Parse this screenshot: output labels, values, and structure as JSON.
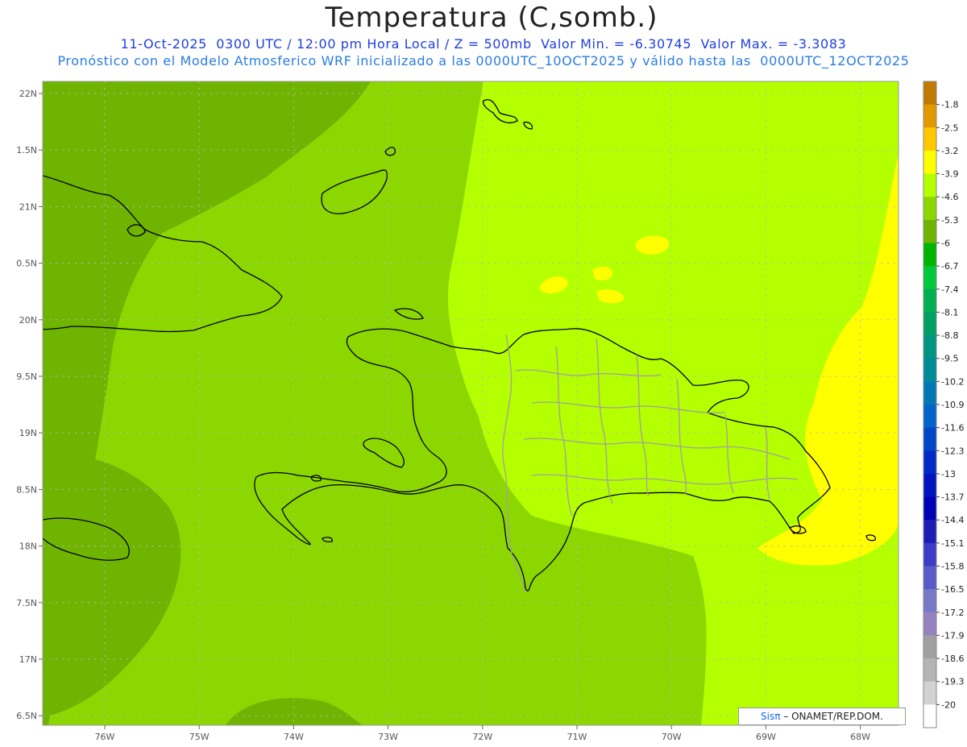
{
  "title": "Temperatura (C,somb.)",
  "subtitle_line1": "11-Oct-2025  0300 UTC / 12:00 pm Hora Local / Z = 500mb  Valor Min. = -6.30745  Valor Max. = -3.3083",
  "subtitle_line2": "Pronóstico con el Modelo Atmosferico WRF inicializado a las 0000UTC_10OCT2025 y válido hasta las  0000UTC_12OCT2025",
  "credit": {
    "brand": "Sisπ",
    "text": "– ONAMET/REP.DOM."
  },
  "axes": {
    "lat_labels": [
      "22N",
      "1.5N",
      "21N",
      "0.5N",
      "20N",
      "9.5N",
      "19N",
      "8.5N",
      "18N",
      "7.5N",
      "17N",
      "6.5N"
    ],
    "lon_labels": [
      "76W",
      "75W",
      "74W",
      "73W",
      "72W",
      "71W",
      "70W",
      "69W",
      "68W"
    ]
  },
  "colorbar": {
    "labels": [
      "-1.8",
      "-2.5",
      "-3.2",
      "-3.9",
      "-4.6",
      "-5.3",
      "-6",
      "-6.7",
      "-7.4",
      "-8.1",
      "-8.8",
      "-9.5",
      "-10.2",
      "-10.9",
      "-11.6",
      "-12.3",
      "-13",
      "-13.7",
      "-14.4",
      "-15.1",
      "-15.8",
      "-16.5",
      "-17.2",
      "-17.9",
      "-18.6",
      "-19.3",
      "-20"
    ],
    "colors": [
      "#c07a00",
      "#e09a00",
      "#ffc800",
      "#ffff00",
      "#b4ff00",
      "#8cd700",
      "#6eb400",
      "#00b400",
      "#00c83c",
      "#00b050",
      "#00a064",
      "#009682",
      "#008c96",
      "#0078b4",
      "#0064c8",
      "#0046c8",
      "#002ac8",
      "#0014c0",
      "#0000b4",
      "#1e1eb4",
      "#3c3cc8",
      "#5a5ac8",
      "#7878c8",
      "#9682c0",
      "#a0a0a0",
      "#b4b4b4",
      "#d2d2d2",
      "#ffffff"
    ]
  },
  "colors": {
    "field_dark": "#6eb400",
    "field_mid": "#8cd700",
    "field_light": "#b4ff00",
    "field_yellow": "#ffff00",
    "coast": "#000000",
    "province_lines": "#a0a0a0",
    "grid": "#b8b8b8"
  }
}
